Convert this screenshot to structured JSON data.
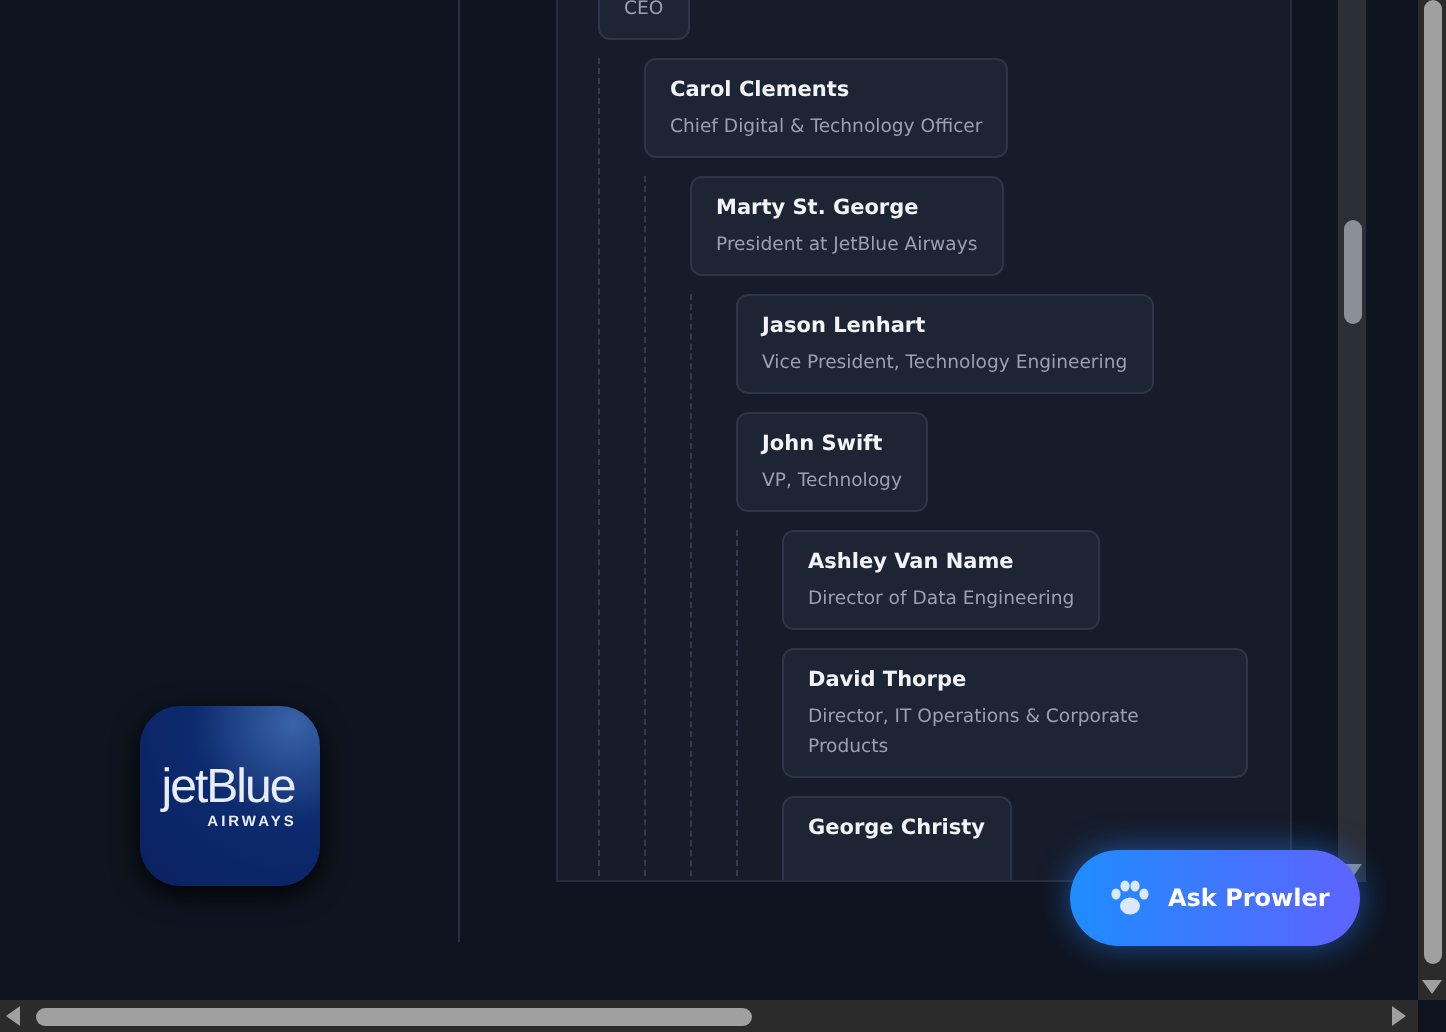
{
  "logo": {
    "wordmark": "jetBlue",
    "subtitle": "AIRWAYS"
  },
  "org_chart": {
    "root": {
      "title": "CEO",
      "children": [
        {
          "name": "Carol Clements",
          "title": "Chief Digital & Technology Officer",
          "children": [
            {
              "name": "Marty St. George",
              "title": "President at JetBlue Airways",
              "children": [
                {
                  "name": "Jason Lenhart",
                  "title": "Vice President, Technology Engineering"
                },
                {
                  "name": "John Swift",
                  "title": "VP, Technology",
                  "children": [
                    {
                      "name": "Ashley Van Name",
                      "title": "Director of Data Engineering"
                    },
                    {
                      "name": "David Thorpe",
                      "title": "Director, IT Operations & Corporate Products"
                    },
                    {
                      "name": "George Christy"
                    }
                  ]
                }
              ]
            }
          ]
        }
      ]
    }
  },
  "assistant_button": {
    "label": "Ask Prowler"
  }
}
